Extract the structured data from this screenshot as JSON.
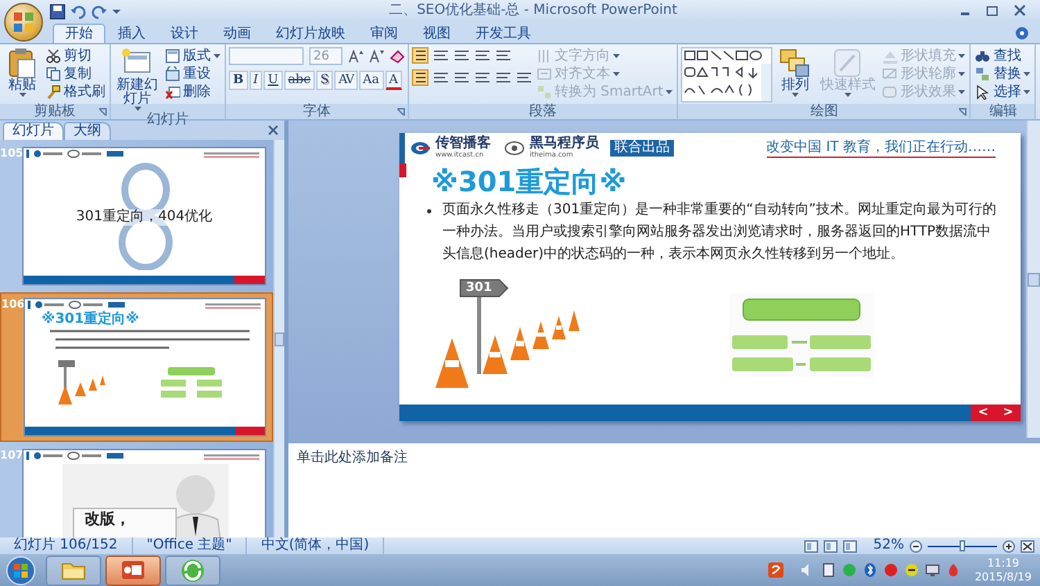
{
  "window": {
    "title": "二、SEO优化基础-总 - Microsoft PowerPoint"
  },
  "ribbon_tabs": [
    {
      "label": "开始",
      "selected": true
    },
    {
      "label": "插入",
      "selected": false
    },
    {
      "label": "设计",
      "selected": false
    },
    {
      "label": "动画",
      "selected": false
    },
    {
      "label": "幻灯片放映",
      "selected": false
    },
    {
      "label": "审阅",
      "selected": false
    },
    {
      "label": "视图",
      "selected": false
    },
    {
      "label": "开发工具",
      "selected": false
    }
  ],
  "ribbon_groups": [
    {
      "kind": "clipboard",
      "label": "剪贴板",
      "launcher": true,
      "items": [
        {
          "kind": "large",
          "label": "粘贴",
          "disabled": false,
          "dropdown": true
        },
        {
          "kind": "small",
          "label": "剪切",
          "disabled": false,
          "dropdown": false
        },
        {
          "kind": "small",
          "label": "复制",
          "disabled": false,
          "dropdown": false
        },
        {
          "kind": "small",
          "label": "格式刷",
          "disabled": false,
          "dropdown": false
        }
      ]
    },
    {
      "kind": "slides",
      "label": "幻灯片",
      "launcher": false,
      "items": [
        {
          "kind": "large",
          "label": "新建幻灯片",
          "disabled": false,
          "dropdown": true
        },
        {
          "kind": "small",
          "label": "版式",
          "disabled": false,
          "dropdown": true
        },
        {
          "kind": "small",
          "label": "重设",
          "disabled": false,
          "dropdown": false
        },
        {
          "kind": "small",
          "label": "删除",
          "disabled": false,
          "dropdown": false
        }
      ]
    },
    {
      "kind": "font",
      "label": "字体",
      "launcher": true,
      "font_size": "26",
      "format_buttons": [
        {
          "kind": "bold",
          "label": "B"
        },
        {
          "kind": "italic",
          "label": "I"
        },
        {
          "kind": "underline",
          "label": "U"
        },
        {
          "kind": "strike",
          "label": "abc"
        },
        {
          "kind": "shadow",
          "label": "S"
        },
        {
          "kind": "spacing",
          "label": "AV"
        },
        {
          "kind": "case",
          "label": "Aa"
        },
        {
          "kind": "color",
          "label": "A"
        }
      ]
    },
    {
      "kind": "paragraph",
      "label": "段落",
      "launcher": false,
      "items": [
        {
          "kind": "small",
          "label": "文字方向",
          "disabled": true,
          "dropdown": true
        },
        {
          "kind": "small",
          "label": "对齐文本",
          "disabled": true,
          "dropdown": true
        },
        {
          "kind": "small",
          "label": "转换为 SmartArt",
          "disabled": true,
          "dropdown": true
        }
      ]
    },
    {
      "kind": "drawing",
      "label": "绘图",
      "launcher": true,
      "items": [
        {
          "kind": "large",
          "label": "排列",
          "disabled": false,
          "dropdown": true
        },
        {
          "kind": "large",
          "label": "快速样式",
          "disabled": true,
          "dropdown": true
        },
        {
          "kind": "small",
          "label": "形状填充",
          "disabled": true,
          "dropdown": true
        },
        {
          "kind": "small",
          "label": "形状轮廓",
          "disabled": true,
          "dropdown": true
        },
        {
          "kind": "small",
          "label": "形状效果",
          "disabled": true,
          "dropdown": true
        }
      ]
    },
    {
      "kind": "editing",
      "label": "编辑",
      "launcher": false,
      "items": [
        {
          "kind": "small",
          "label": "查找",
          "disabled": false,
          "dropdown": false
        },
        {
          "kind": "small",
          "label": "替换",
          "disabled": false,
          "dropdown": true
        },
        {
          "kind": "small",
          "label": "选择",
          "disabled": false,
          "dropdown": true
        }
      ]
    }
  ],
  "panel_tabs": [
    {
      "label": "幻灯片",
      "selected": true
    },
    {
      "label": "大纲",
      "selected": false
    }
  ],
  "slides": [
    {
      "number": "105",
      "kind": "section",
      "selected": false,
      "text": "301重定向，404优化"
    },
    {
      "number": "106",
      "kind": "content",
      "selected": true,
      "text": "※301重定向※"
    },
    {
      "number": "107",
      "kind": "illustration",
      "selected": false,
      "text": "改版，"
    }
  ],
  "slide": {
    "header": {
      "logo_primary": "传智播客",
      "url_primary": "www.itcast.cn",
      "logo_secondary": "黑马程序员",
      "url_secondary": "itheima.com",
      "tag": "联合出品",
      "slogan": "改变中国 IT 教育，我们正在行动……"
    },
    "title": "※301重定向※",
    "bullets": [
      "页面永久性移走（301重定向）是一种非常重要的“自动转向”技术。网址重定向最为可行的一种办法。当用户或搜索引擎向网站服务器发出浏览请求时，服务器返回的HTTP数据流中头信息(header)中的状态码的一种，表示本网页永久性转移到另一个地址。"
    ],
    "sign_text": "301",
    "nav": [
      "<",
      ">"
    ]
  },
  "notes": {
    "placeholder": "单击此处添加备注"
  },
  "status_bar": {
    "slide": "幻灯片 106/152",
    "theme": "\"Office 主题\"",
    "language": "中文(简体，中国)",
    "zoom": {
      "reading": "52%",
      "level": 0.5
    }
  },
  "taskbar": {
    "apps": [
      {
        "kind": "explorer",
        "selected": false
      },
      {
        "kind": "powerpoint",
        "selected": true
      },
      {
        "kind": "browser",
        "selected": false
      }
    ],
    "time": "11:19",
    "date": "2015/8/19"
  }
}
